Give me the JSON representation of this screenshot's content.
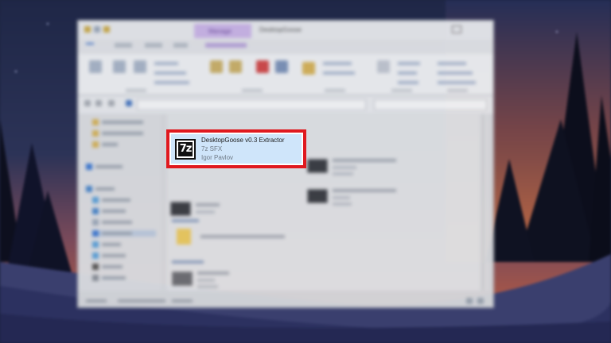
{
  "window": {
    "title": "DesktopGoose",
    "context_tab": "Manage"
  },
  "tooltip": {
    "icon": "7z-archive-icon",
    "icon_text": "7z",
    "title": "DesktopGoose v0.3 Extractor",
    "type": "7z SFX",
    "company": "Igor Pavlov"
  },
  "colors": {
    "highlight_border": "#e0191f",
    "tooltip_bg": "#cfe5fa",
    "sky_top": "#1f2747",
    "sky_bottom": "#c8603a",
    "snow": "#3a3f6e"
  }
}
